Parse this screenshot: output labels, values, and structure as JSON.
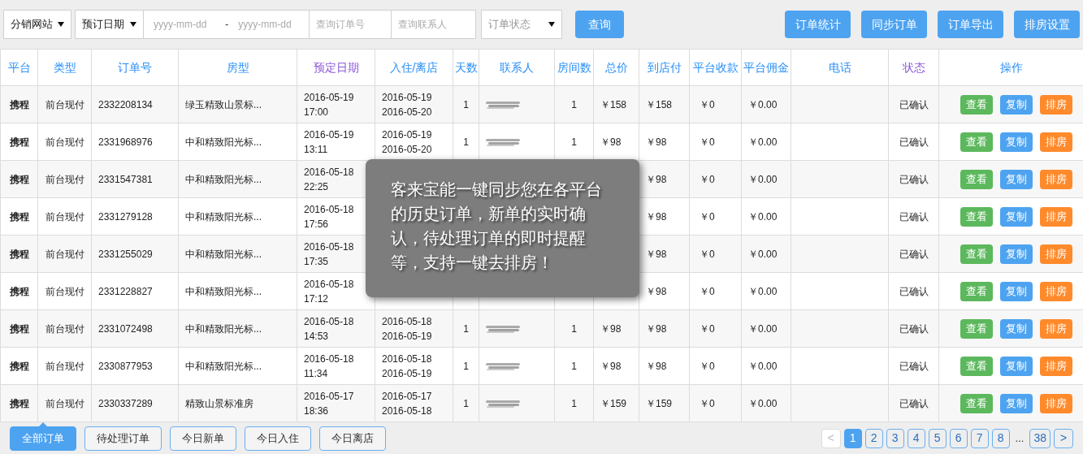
{
  "filters": {
    "site_select": "分销网站",
    "date_type_select": "预订日期",
    "date_from": {
      "placeholder": "yyyy-mm-dd"
    },
    "date_separator": "-",
    "date_to": {
      "placeholder": "yyyy-mm-dd"
    },
    "order_no": {
      "placeholder": "查询订单号"
    },
    "contact": {
      "placeholder": "查询联系人"
    },
    "status_select": "订单状态",
    "search_button": "查询"
  },
  "toolbar_buttons": [
    "订单统计",
    "同步订单",
    "订单导出",
    "排房设置"
  ],
  "table": {
    "columns": [
      {
        "label": "平台",
        "color": "#2a8ff7"
      },
      {
        "label": "类型",
        "color": "#2a8ff7"
      },
      {
        "label": "订单号",
        "color": "#2a8ff7"
      },
      {
        "label": "房型",
        "color": "#2a8ff7"
      },
      {
        "label": "预定日期",
        "color": "#8a56d6"
      },
      {
        "label": "入住/离店",
        "color": "#2a8ff7"
      },
      {
        "label": "天数",
        "color": "#2a8ff7"
      },
      {
        "label": "联系人",
        "color": "#2a8ff7"
      },
      {
        "label": "房间数",
        "color": "#2a8ff7"
      },
      {
        "label": "总价",
        "color": "#2a8ff7"
      },
      {
        "label": "到店付",
        "color": "#2a8ff7"
      },
      {
        "label": "平台收款",
        "color": "#2a8ff7"
      },
      {
        "label": "平台佣金",
        "color": "#2a8ff7"
      },
      {
        "label": "电话",
        "color": "#2a8ff7"
      },
      {
        "label": "状态",
        "color": "#8a56d6"
      },
      {
        "label": "操作",
        "color": "#2a8ff7"
      }
    ],
    "rows": [
      {
        "platform": "携程",
        "type": "前台现付",
        "order_no": "2332208134",
        "room": "绿玉精致山景标...",
        "booked": [
          "2016-05-19",
          "17:00"
        ],
        "stay": [
          "2016-05-19",
          "2016-05-20"
        ],
        "days": "1",
        "contact_redacted": true,
        "rooms": "1",
        "total": "￥158",
        "pay_at_hotel": "￥158",
        "platform_received": "￥0",
        "commission": "￥0.00",
        "status": "已确认",
        "actions": [
          {
            "label": "查看",
            "kind": "view"
          },
          {
            "label": "复制",
            "kind": "copy"
          },
          {
            "label": "排房",
            "kind": "assign"
          }
        ]
      },
      {
        "platform": "携程",
        "type": "前台现付",
        "order_no": "2331968976",
        "room": "中和精致阳光标...",
        "booked": [
          "2016-05-19",
          "13:11"
        ],
        "stay": [
          "2016-05-19",
          "2016-05-20"
        ],
        "days": "1",
        "contact_redacted": true,
        "rooms": "1",
        "total": "￥98",
        "pay_at_hotel": "￥98",
        "platform_received": "￥0",
        "commission": "￥0.00",
        "status": "已确认",
        "actions": [
          {
            "label": "查看",
            "kind": "view"
          },
          {
            "label": "复制",
            "kind": "copy"
          },
          {
            "label": "排房",
            "kind": "assign"
          }
        ]
      },
      {
        "platform": "携程",
        "type": "前台现付",
        "order_no": "2331547381",
        "room": "中和精致阳光标...",
        "booked": [
          "2016-05-18",
          "22:25"
        ],
        "pay_at_hotel": "￥98",
        "platform_received": "￥0",
        "commission": "￥0.00",
        "status": "已确认",
        "actions": [
          {
            "label": "查看",
            "kind": "view"
          },
          {
            "label": "复制",
            "kind": "copy"
          },
          {
            "label": "排房",
            "kind": "assign"
          }
        ]
      },
      {
        "platform": "携程",
        "type": "前台现付",
        "order_no": "2331279128",
        "room": "中和精致阳光标...",
        "booked": [
          "2016-05-18",
          "17:56"
        ],
        "pay_at_hotel": "￥98",
        "platform_received": "￥0",
        "commission": "￥0.00",
        "status": "已确认",
        "actions": [
          {
            "label": "查看",
            "kind": "view"
          },
          {
            "label": "复制",
            "kind": "copy"
          },
          {
            "label": "排房",
            "kind": "assign"
          }
        ]
      },
      {
        "platform": "携程",
        "type": "前台现付",
        "order_no": "2331255029",
        "room": "中和精致阳光标...",
        "booked": [
          "2016-05-18",
          "17:35"
        ],
        "pay_at_hotel": "￥98",
        "platform_received": "￥0",
        "commission": "￥0.00",
        "status": "已确认",
        "actions": [
          {
            "label": "查看",
            "kind": "view"
          },
          {
            "label": "复制",
            "kind": "copy"
          },
          {
            "label": "排房",
            "kind": "assign"
          }
        ]
      },
      {
        "platform": "携程",
        "type": "前台现付",
        "order_no": "2331228827",
        "room": "中和精致阳光标...",
        "booked": [
          "2016-05-18",
          "17:12"
        ],
        "pay_at_hotel": "￥98",
        "platform_received": "￥0",
        "commission": "￥0.00",
        "status": "已确认",
        "actions": [
          {
            "label": "查看",
            "kind": "view"
          },
          {
            "label": "复制",
            "kind": "copy"
          },
          {
            "label": "排房",
            "kind": "assign"
          }
        ]
      },
      {
        "platform": "携程",
        "type": "前台现付",
        "order_no": "2331072498",
        "room": "中和精致阳光标...",
        "booked": [
          "2016-05-18",
          "14:53"
        ],
        "stay": [
          "2016-05-18",
          "2016-05-19"
        ],
        "days": "1",
        "contact_redacted": true,
        "rooms": "1",
        "total": "￥98",
        "pay_at_hotel": "￥98",
        "platform_received": "￥0",
        "commission": "￥0.00",
        "status": "已确认",
        "actions": [
          {
            "label": "查看",
            "kind": "view"
          },
          {
            "label": "复制",
            "kind": "copy"
          },
          {
            "label": "排房",
            "kind": "assign"
          }
        ]
      },
      {
        "platform": "携程",
        "type": "前台现付",
        "order_no": "2330877953",
        "room": "中和精致阳光标...",
        "booked": [
          "2016-05-18",
          "11:34"
        ],
        "stay": [
          "2016-05-18",
          "2016-05-19"
        ],
        "days": "1",
        "contact_redacted": true,
        "rooms": "1",
        "total": "￥98",
        "pay_at_hotel": "￥98",
        "platform_received": "￥0",
        "commission": "￥0.00",
        "status": "已确认",
        "actions": [
          {
            "label": "查看",
            "kind": "view"
          },
          {
            "label": "复制",
            "kind": "copy"
          },
          {
            "label": "排房",
            "kind": "assign"
          }
        ]
      },
      {
        "platform": "携程",
        "type": "前台现付",
        "order_no": "2330337289",
        "room": "精致山景标准房",
        "booked": [
          "2016-05-17",
          "18:36"
        ],
        "stay": [
          "2016-05-17",
          "2016-05-18"
        ],
        "days": "1",
        "contact_redacted": true,
        "rooms": "1",
        "total": "￥159",
        "pay_at_hotel": "￥159",
        "platform_received": "￥0",
        "commission": "￥0.00",
        "status": "已确认",
        "actions": [
          {
            "label": "查看",
            "kind": "view"
          },
          {
            "label": "复制",
            "kind": "copy"
          },
          {
            "label": "排房",
            "kind": "assign"
          }
        ]
      }
    ]
  },
  "tooltip": "客来宝能一键同步您在各平台的历史订单，新单的实时确认，待处理订单的即时提醒等，支持一键去排房！",
  "order_tabs": [
    {
      "label": "全部订单",
      "selected": true
    },
    {
      "label": "待处理订单",
      "selected": false
    },
    {
      "label": "今日新单",
      "selected": false
    },
    {
      "label": "今日入住",
      "selected": false
    },
    {
      "label": "今日离店",
      "selected": false
    }
  ],
  "pagination": {
    "prev": {
      "label": "<",
      "disabled": true
    },
    "pages": [
      {
        "label": "1",
        "selected": true
      },
      {
        "label": "2",
        "selected": false
      },
      {
        "label": "3",
        "selected": false
      },
      {
        "label": "4",
        "selected": false
      },
      {
        "label": "5",
        "selected": false
      },
      {
        "label": "6",
        "selected": false
      },
      {
        "label": "7",
        "selected": false
      },
      {
        "label": "8",
        "selected": false
      }
    ],
    "ellipsis": "...",
    "last": {
      "label": "38",
      "selected": false
    },
    "next": {
      "label": ">",
      "disabled": false
    }
  }
}
